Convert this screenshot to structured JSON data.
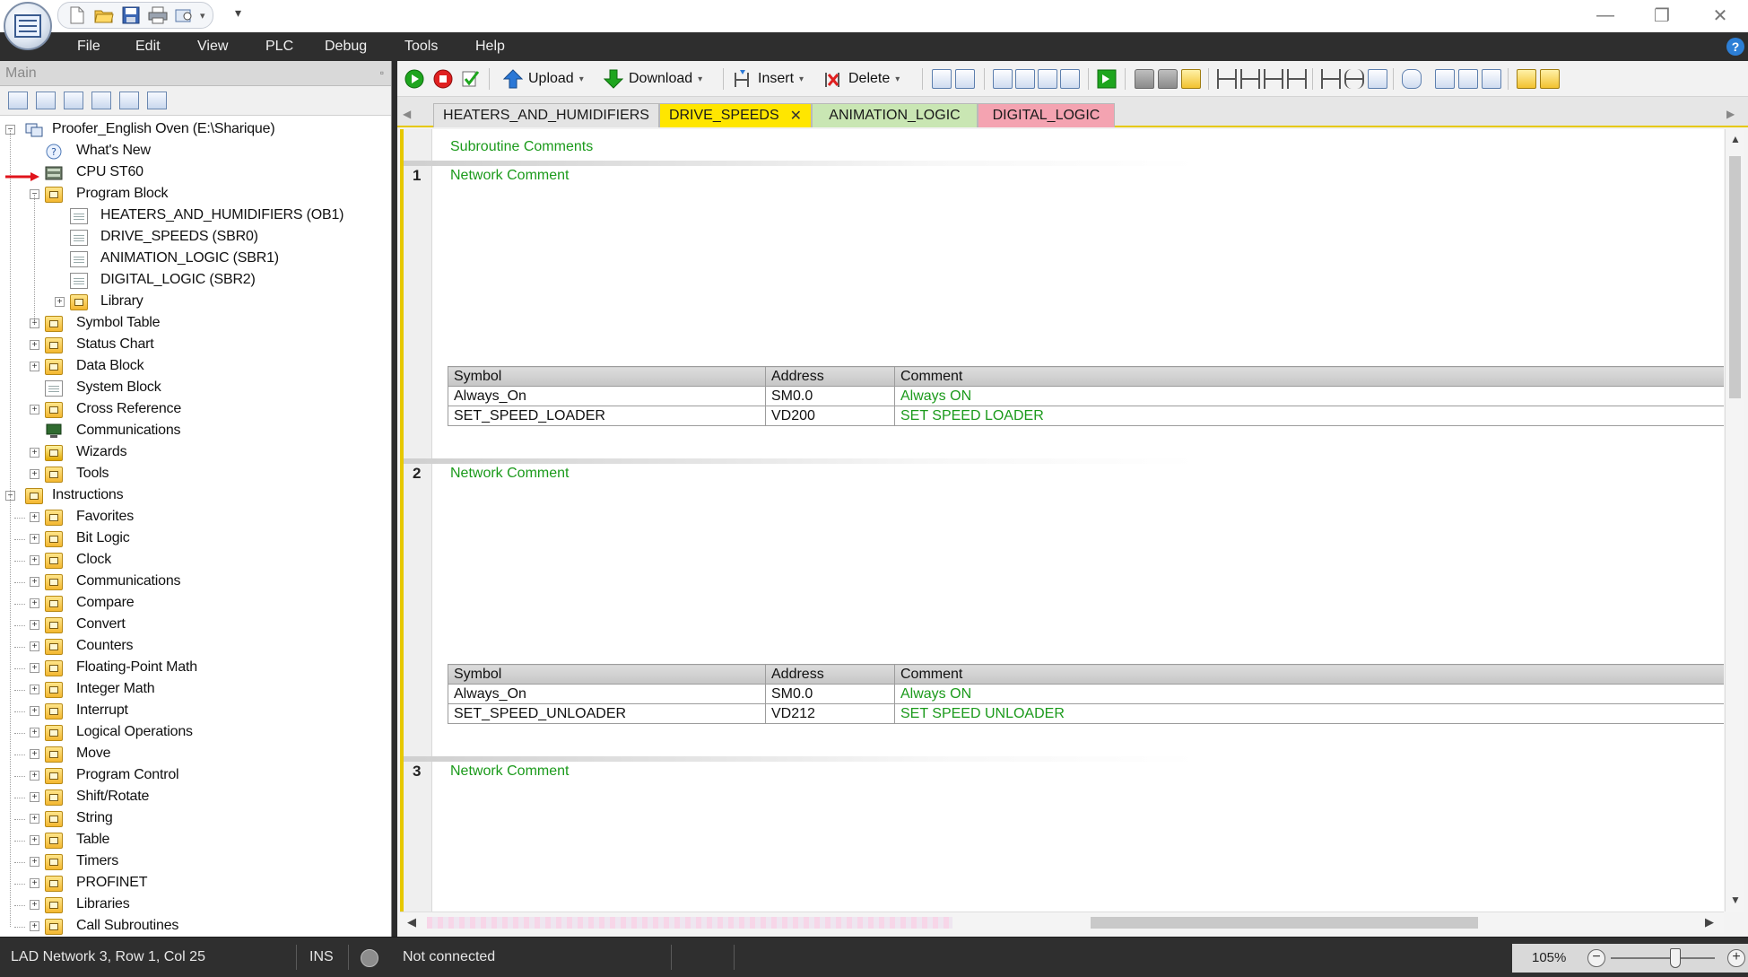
{
  "menu": {
    "items": [
      "File",
      "Edit",
      "View",
      "PLC",
      "Debug",
      "Tools",
      "Help"
    ],
    "help_glyph": "?"
  },
  "window": {
    "minimize_glyph": "—",
    "restore_glyph": "❐",
    "close_glyph": "✕",
    "qat_more_glyph": "▾"
  },
  "left_panel": {
    "title": "Main",
    "pin_glyph": "▫",
    "tree": [
      {
        "label": "Proofer_English Oven (E:\\Sharique)",
        "icon": "project-icon"
      },
      {
        "label": "What's New",
        "icon": "whats-new-icon"
      },
      {
        "label": "CPU ST60",
        "icon": "cpu-icon"
      },
      {
        "label": "Program Block",
        "icon": "folder-icon"
      },
      {
        "label": "HEATERS_AND_HUMIDIFIERS (OB1)",
        "icon": "program-icon"
      },
      {
        "label": "DRIVE_SPEEDS (SBR0)",
        "icon": "program-icon"
      },
      {
        "label": "ANIMATION_LOGIC (SBR1)",
        "icon": "program-icon"
      },
      {
        "label": "DIGITAL_LOGIC (SBR2)",
        "icon": "program-icon"
      },
      {
        "label": "Library",
        "icon": "library-icon"
      },
      {
        "label": "Symbol Table",
        "icon": "folder-icon"
      },
      {
        "label": "Status Chart",
        "icon": "folder-icon"
      },
      {
        "label": "Data Block",
        "icon": "folder-icon"
      },
      {
        "label": "System Block",
        "icon": "system-block-icon"
      },
      {
        "label": "Cross Reference",
        "icon": "folder-icon"
      },
      {
        "label": "Communications",
        "icon": "communications-icon"
      },
      {
        "label": "Wizards",
        "icon": "wizard-icon"
      },
      {
        "label": "Tools",
        "icon": "folder-icon"
      },
      {
        "label": "Instructions",
        "icon": "folder-icon"
      },
      {
        "label": "Favorites",
        "icon": "folder-icon"
      },
      {
        "label": "Bit Logic",
        "icon": "folder-icon"
      },
      {
        "label": "Clock",
        "icon": "folder-icon"
      },
      {
        "label": "Communications",
        "icon": "folder-icon"
      },
      {
        "label": "Compare",
        "icon": "folder-icon"
      },
      {
        "label": "Convert",
        "icon": "folder-icon"
      },
      {
        "label": "Counters",
        "icon": "folder-icon"
      },
      {
        "label": "Floating-Point Math",
        "icon": "folder-icon"
      },
      {
        "label": "Integer Math",
        "icon": "folder-icon"
      },
      {
        "label": "Interrupt",
        "icon": "folder-icon"
      },
      {
        "label": "Logical Operations",
        "icon": "folder-icon"
      },
      {
        "label": "Move",
        "icon": "folder-icon"
      },
      {
        "label": "Program Control",
        "icon": "folder-icon"
      },
      {
        "label": "Shift/Rotate",
        "icon": "folder-icon"
      },
      {
        "label": "String",
        "icon": "folder-icon"
      },
      {
        "label": "Table",
        "icon": "folder-icon"
      },
      {
        "label": "Timers",
        "icon": "folder-icon"
      },
      {
        "label": "PROFINET",
        "icon": "folder-icon"
      },
      {
        "label": "Libraries",
        "icon": "folder-icon"
      },
      {
        "label": "Call Subroutines",
        "icon": "folder-icon"
      }
    ]
  },
  "toolbar": {
    "upload_label": "Upload",
    "download_label": "Download",
    "insert_label": "Insert",
    "delete_label": "Delete",
    "dropdown_glyph": "▾"
  },
  "tabs": [
    {
      "label": "HEATERS_AND_HUMIDIFIERS",
      "color": "#e4e4e4"
    },
    {
      "label": "DRIVE_SPEEDS",
      "color": "#ffe600",
      "active": true
    },
    {
      "label": "ANIMATION_LOGIC",
      "color": "#c9e6b3"
    },
    {
      "label": "DIGITAL_LOGIC",
      "color": "#f4a3b1"
    }
  ],
  "tab_close_glyph": "✕",
  "tab_nav": {
    "left": "◀",
    "right": "▶"
  },
  "editor": {
    "subroutine_comments": "Subroutine Comments",
    "table_headers": {
      "symbol": "Symbol",
      "address": "Address",
      "comment": "Comment"
    },
    "networks": [
      {
        "number": "1",
        "comment": "Network Comment",
        "symbols": [
          {
            "symbol": "Always_On",
            "address": "SM0.0",
            "comment": "Always ON"
          },
          {
            "symbol": "SET_SPEED_LOADER",
            "address": "VD200",
            "comment": "SET SPEED LOADER"
          }
        ]
      },
      {
        "number": "2",
        "comment": "Network Comment",
        "symbols": [
          {
            "symbol": "Always_On",
            "address": "SM0.0",
            "comment": "Always ON"
          },
          {
            "symbol": "SET_SPEED_UNLOADER",
            "address": "VD212",
            "comment": "SET SPEED UNLOADER"
          }
        ]
      },
      {
        "number": "3",
        "comment": "Network Comment",
        "symbols": []
      }
    ]
  },
  "scroll": {
    "up": "▲",
    "down": "▼",
    "left": "◀",
    "right": "▶"
  },
  "status": {
    "position": "LAD Network 3, Row 1, Col 25",
    "mode": "INS",
    "connection": "Not connected",
    "zoom": "105%",
    "zoom_fraction": 0.62,
    "zoom_out_glyph": "−",
    "zoom_in_glyph": "+"
  },
  "colors": {
    "accent_yellow": "#e6c800",
    "comment_green": "#1b9a1b",
    "menubar_bg": "#2e2e2e"
  }
}
